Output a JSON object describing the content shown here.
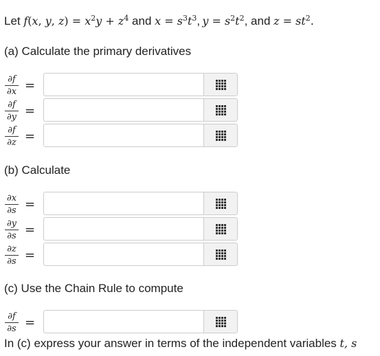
{
  "intro": {
    "let": "Let ",
    "and1": " and ",
    "sep": ",",
    "and2": ", and "
  },
  "part_a": {
    "label": "(a) Calculate the primary derivatives"
  },
  "part_b": {
    "label": "(b) Calculate"
  },
  "part_c": {
    "label": "(c) Use the Chain Rule to compute"
  },
  "footer": {
    "text": "In (c) express your answer in terms of the independent variables ",
    "vars": "t, s"
  },
  "fields": [
    {
      "num": "∂f",
      "den": "∂x",
      "value": ""
    },
    {
      "num": "∂f",
      "den": "∂y",
      "value": ""
    },
    {
      "num": "∂f",
      "den": "∂z",
      "value": ""
    },
    {
      "num": "∂x",
      "den": "∂s",
      "value": ""
    },
    {
      "num": "∂y",
      "den": "∂s",
      "value": ""
    },
    {
      "num": "∂z",
      "den": "∂s",
      "value": ""
    },
    {
      "num": "∂f",
      "den": "∂s",
      "value": ""
    }
  ],
  "equals": "=",
  "icon": "matrix-palette-icon"
}
